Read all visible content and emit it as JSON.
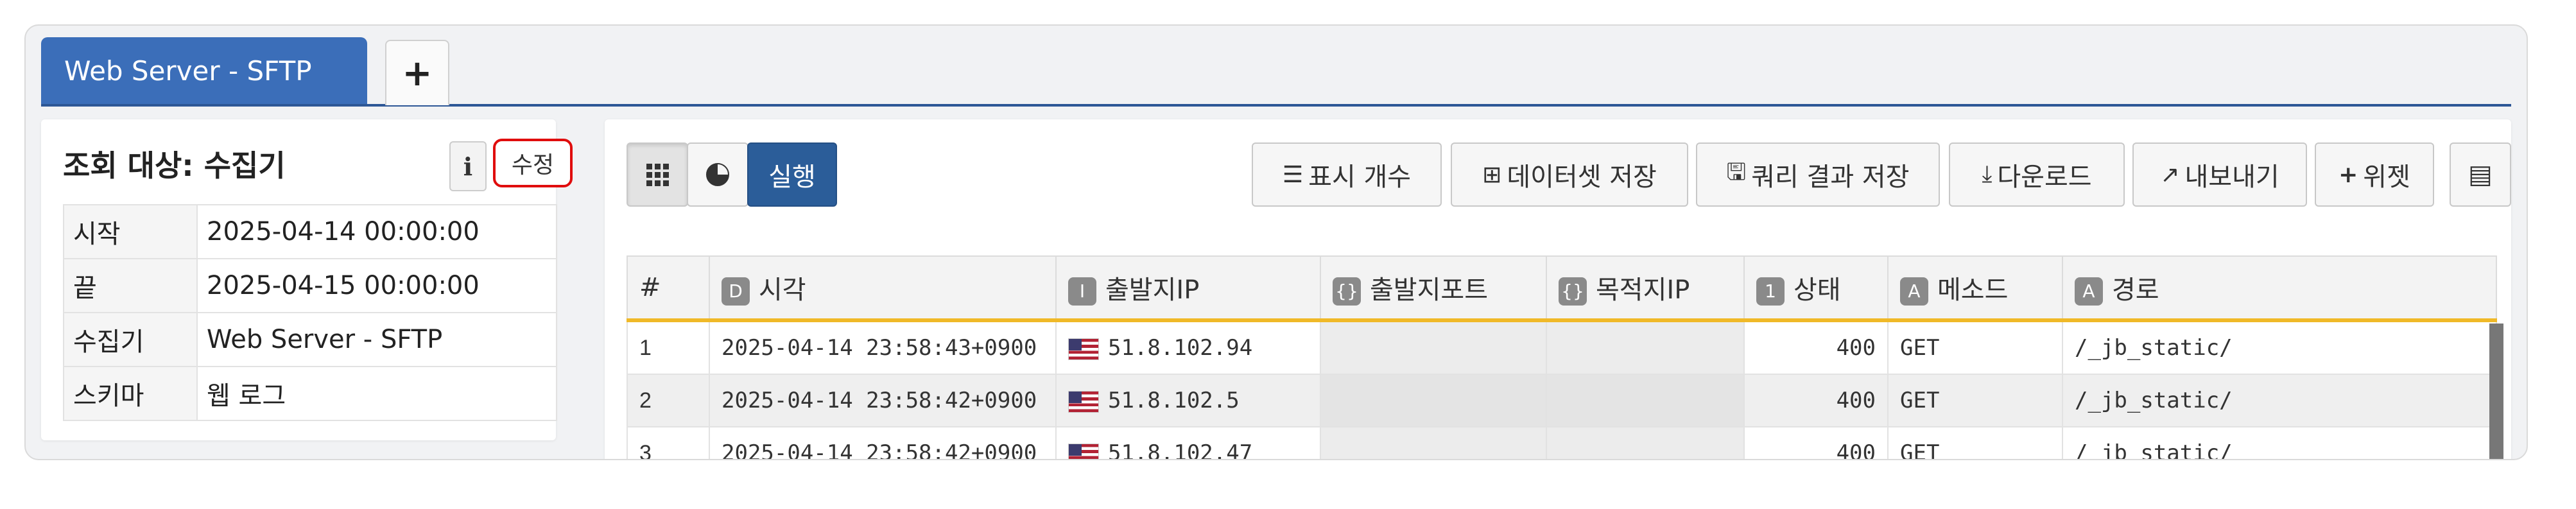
{
  "tabs": [
    {
      "label": "Web Server - SFTP",
      "active": true
    },
    {
      "label": "+",
      "active": false
    }
  ],
  "left_panel": {
    "title": "조회 대상: 수집기",
    "info_label": "i",
    "edit_label": "수정",
    "rows": [
      {
        "key": "시작",
        "value": "2025-04-14 00:00:00"
      },
      {
        "key": "끝",
        "value": "2025-04-15 00:00:00"
      },
      {
        "key": "수집기",
        "value": "Web Server - SFTP"
      },
      {
        "key": "스키마",
        "value": "웹 로그"
      }
    ]
  },
  "toolbar": {
    "run_label": "실행",
    "display_count_label": "표시 개수",
    "save_dataset_label": "데이터셋 저장",
    "save_query_label": "쿼리 결과 저장",
    "download_label": "다운로드",
    "export_label": "내보내기",
    "widget_label": "위젯"
  },
  "table": {
    "columns": [
      {
        "badge": "",
        "label": "#"
      },
      {
        "badge": "D",
        "label": "시각"
      },
      {
        "badge": "I",
        "label": "출발지IP"
      },
      {
        "badge": "{}",
        "label": "출발지포트"
      },
      {
        "badge": "{}",
        "label": "목적지IP"
      },
      {
        "badge": "1",
        "label": "상태"
      },
      {
        "badge": "A",
        "label": "메소드"
      },
      {
        "badge": "A",
        "label": "경로"
      }
    ],
    "rows": [
      {
        "n": "1",
        "time": "2025-04-14 23:58:43+0900",
        "src_ip": "51.8.102.94",
        "src_port": "",
        "dst_ip": "",
        "status": "400",
        "method": "GET",
        "path": "/_jb_static/"
      },
      {
        "n": "2",
        "time": "2025-04-14 23:58:42+0900",
        "src_ip": "51.8.102.5",
        "src_port": "",
        "dst_ip": "",
        "status": "400",
        "method": "GET",
        "path": "/_jb_static/"
      },
      {
        "n": "3",
        "time": "2025-04-14 23:58:42+0900",
        "src_ip": "51.8.102.47",
        "src_port": "",
        "dst_ip": "",
        "status": "400",
        "method": "GET",
        "path": "/_jb_static/"
      }
    ]
  },
  "colors": {
    "tab_active": "#3b6eb9",
    "run_button": "#2b5d99",
    "header_accent": "#f0b928",
    "edit_highlight": "#e00d0d"
  },
  "icons": [
    "plus-icon",
    "info-icon",
    "grid-icon",
    "pie-chart-icon",
    "list-icon",
    "plus-square-icon",
    "save-icon",
    "download-icon",
    "export-icon",
    "plus-icon",
    "table-settings-icon",
    "us-flag-icon"
  ]
}
